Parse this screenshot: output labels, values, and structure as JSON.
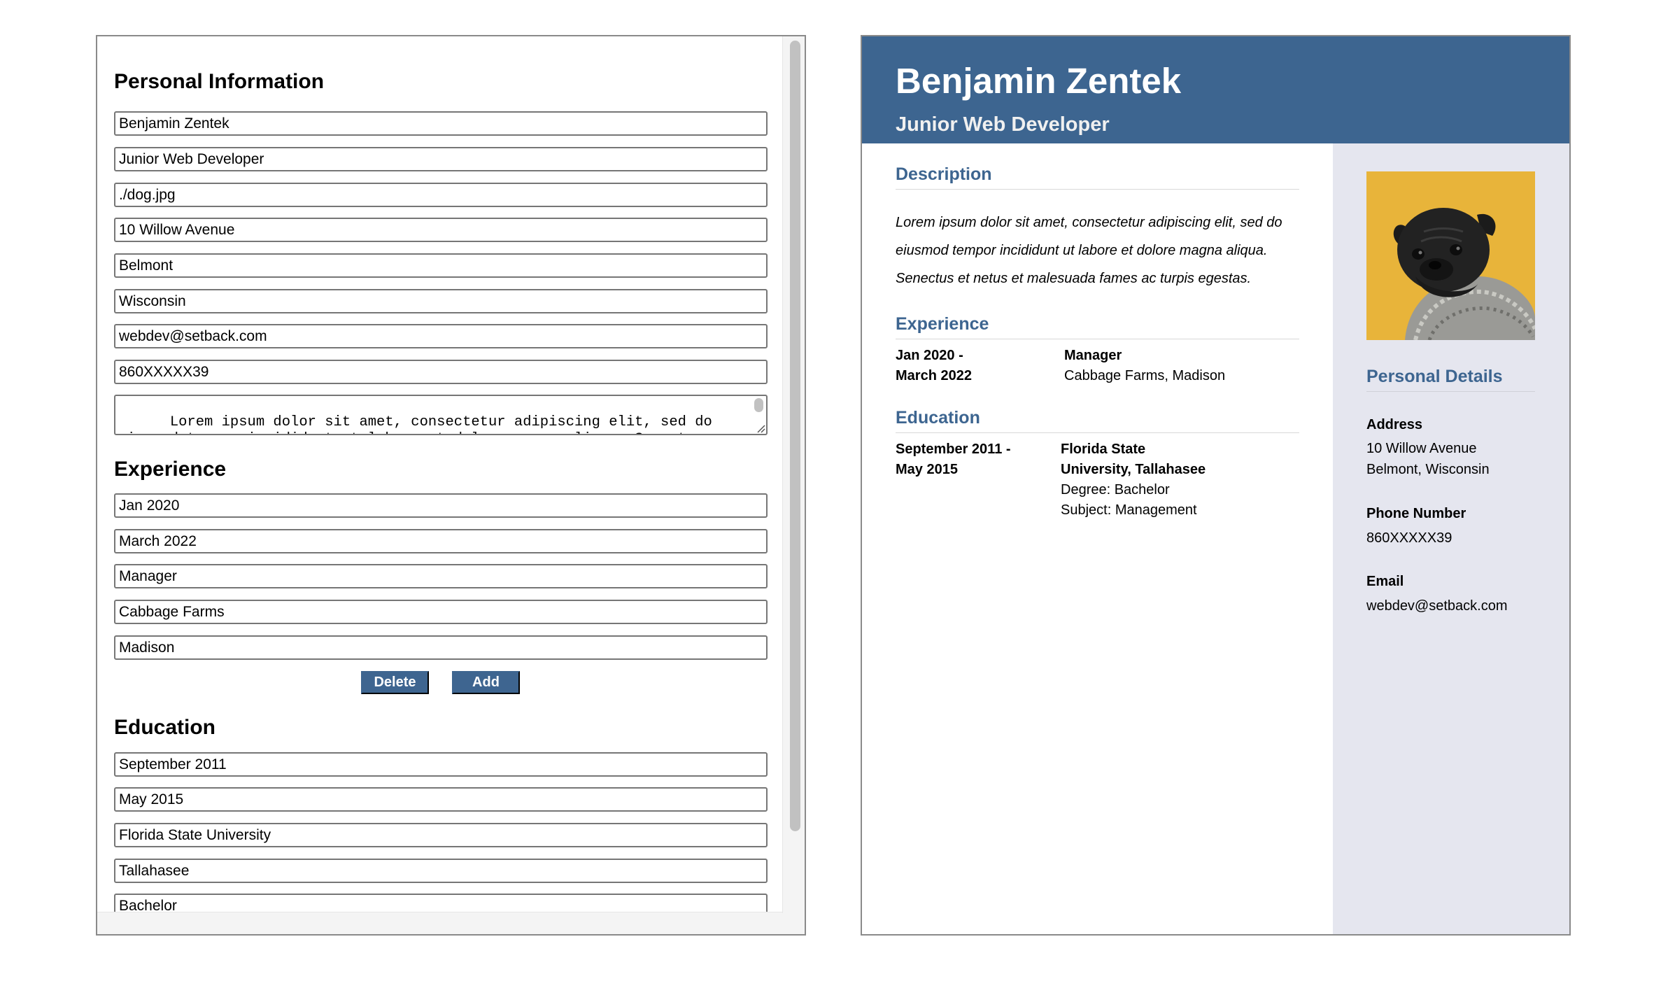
{
  "editor": {
    "personal_heading": "Personal Information",
    "personal_fields": [
      "Benjamin Zentek",
      "Junior Web Developer",
      "./dog.jpg",
      "10 Willow Avenue",
      "Belmont",
      "Wisconsin",
      "webdev@setback.com",
      "860XXXXX39"
    ],
    "description_text": "Lorem ipsum dolor sit amet, consectetur adipiscing elit, sed do eiusmod tempor incididunt ut labore et dolore magna aliqua. Senectus",
    "experience_heading": "Experience",
    "experience_fields": [
      "Jan 2020",
      "March 2022",
      "Manager",
      "Cabbage Farms",
      "Madison"
    ],
    "delete_label": "Delete",
    "add_label": "Add",
    "education_heading": "Education",
    "education_fields": [
      "September 2011",
      "May 2015",
      "Florida State University",
      "Tallahasee",
      "Bachelor"
    ]
  },
  "preview": {
    "name": "Benjamin Zentek",
    "title": "Junior Web Developer",
    "description_heading": "Description",
    "description": "Lorem ipsum dolor sit amet, consectetur adipiscing elit, sed do eiusmod tempor incididunt ut labore et dolore magna aliqua. Senectus et netus et malesuada fames ac turpis egestas.",
    "experience_heading": "Experience",
    "experience": {
      "from": "Jan 2020 -",
      "to": "March 2022",
      "position": "Manager",
      "company_city": "Cabbage Farms, Madison"
    },
    "education_heading": "Education",
    "education": {
      "from": "September 2011 -",
      "to": "May 2015",
      "school_line1": "Florida State",
      "school_line2": "University, Tallahasee",
      "degree": "Degree: Bachelor",
      "subject": "Subject: Management"
    },
    "sidebar": {
      "heading": "Personal Details",
      "address_label": "Address",
      "address_line1": "10 Willow Avenue",
      "address_line2": "Belmont, Wisconsin",
      "phone_label": "Phone Number",
      "phone": "860XXXXX39",
      "email_label": "Email",
      "email": "webdev@setback.com"
    }
  },
  "colors": {
    "accent": "#3d6590",
    "sidebar_bg": "#e5e6ef",
    "photo_bg": "#e8b43a"
  }
}
